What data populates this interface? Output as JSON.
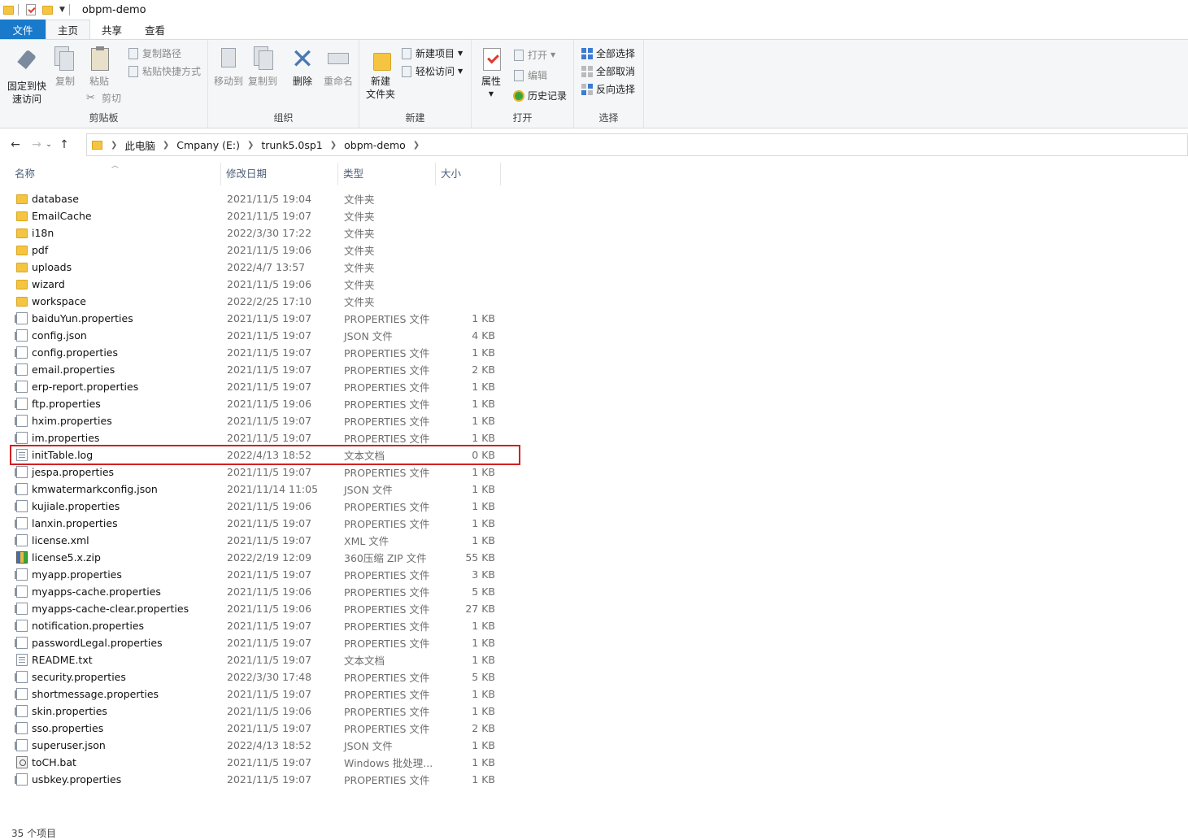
{
  "window": {
    "title": "obpm-demo"
  },
  "tabs": [
    {
      "label": "文件"
    },
    {
      "label": "主页"
    },
    {
      "label": "共享"
    },
    {
      "label": "查看"
    }
  ],
  "ribbon": {
    "clipboard": {
      "label": "剪贴板",
      "pin": "固定到快速访问",
      "pin_line1": "固定到快",
      "pin_line2": "速访问",
      "copy": "复制",
      "paste": "粘贴",
      "copy_path": "复制路径",
      "paste_shortcut": "粘贴快捷方式",
      "cut": "剪切"
    },
    "organize": {
      "label": "组织",
      "move_to": "移动到",
      "copy_to": "复制到",
      "delete": "删除",
      "rename": "重命名"
    },
    "new": {
      "label": "新建",
      "new_folder_line1": "新建",
      "new_folder_line2": "文件夹",
      "new_item": "新建项目",
      "easy_access": "轻松访问"
    },
    "open": {
      "label": "打开",
      "properties": "属性",
      "open": "打开",
      "edit": "编辑",
      "history": "历史记录"
    },
    "select": {
      "label": "选择",
      "select_all": "全部选择",
      "select_none": "全部取消",
      "invert": "反向选择"
    }
  },
  "address": {
    "crumbs": [
      "此电脑",
      "Cmpany (E:)",
      "trunk5.0sp1",
      "obpm-demo"
    ]
  },
  "columns": {
    "name": "名称",
    "date": "修改日期",
    "type": "类型",
    "size": "大小"
  },
  "files": [
    {
      "name": "database",
      "date": "2021/11/5 19:04",
      "type": "文件夹",
      "size": "",
      "icon": "folder"
    },
    {
      "name": "EmailCache",
      "date": "2021/11/5 19:07",
      "type": "文件夹",
      "size": "",
      "icon": "folder"
    },
    {
      "name": "i18n",
      "date": "2022/3/30 17:22",
      "type": "文件夹",
      "size": "",
      "icon": "folder"
    },
    {
      "name": "pdf",
      "date": "2021/11/5 19:06",
      "type": "文件夹",
      "size": "",
      "icon": "folder"
    },
    {
      "name": "uploads",
      "date": "2022/4/7 13:57",
      "type": "文件夹",
      "size": "",
      "icon": "folder"
    },
    {
      "name": "wizard",
      "date": "2021/11/5 19:06",
      "type": "文件夹",
      "size": "",
      "icon": "folder"
    },
    {
      "name": "workspace",
      "date": "2022/2/25 17:10",
      "type": "文件夹",
      "size": "",
      "icon": "folder"
    },
    {
      "name": "baiduYun.properties",
      "date": "2021/11/5 19:07",
      "type": "PROPERTIES 文件",
      "size": "1 KB",
      "icon": "file"
    },
    {
      "name": "config.json",
      "date": "2021/11/5 19:07",
      "type": "JSON 文件",
      "size": "4 KB",
      "icon": "file"
    },
    {
      "name": "config.properties",
      "date": "2021/11/5 19:07",
      "type": "PROPERTIES 文件",
      "size": "1 KB",
      "icon": "file"
    },
    {
      "name": "email.properties",
      "date": "2021/11/5 19:07",
      "type": "PROPERTIES 文件",
      "size": "2 KB",
      "icon": "file"
    },
    {
      "name": "erp-report.properties",
      "date": "2021/11/5 19:07",
      "type": "PROPERTIES 文件",
      "size": "1 KB",
      "icon": "file"
    },
    {
      "name": "ftp.properties",
      "date": "2021/11/5 19:06",
      "type": "PROPERTIES 文件",
      "size": "1 KB",
      "icon": "file"
    },
    {
      "name": "hxim.properties",
      "date": "2021/11/5 19:07",
      "type": "PROPERTIES 文件",
      "size": "1 KB",
      "icon": "file"
    },
    {
      "name": "im.properties",
      "date": "2021/11/5 19:07",
      "type": "PROPERTIES 文件",
      "size": "1 KB",
      "icon": "file"
    },
    {
      "name": "initTable.log",
      "date": "2022/4/13 18:52",
      "type": "文本文档",
      "size": "0 KB",
      "icon": "text",
      "highlighted": true
    },
    {
      "name": "jespa.properties",
      "date": "2021/11/5 19:07",
      "type": "PROPERTIES 文件",
      "size": "1 KB",
      "icon": "file"
    },
    {
      "name": "kmwatermarkconfig.json",
      "date": "2021/11/14 11:05",
      "type": "JSON 文件",
      "size": "1 KB",
      "icon": "file"
    },
    {
      "name": "kujiale.properties",
      "date": "2021/11/5 19:06",
      "type": "PROPERTIES 文件",
      "size": "1 KB",
      "icon": "file"
    },
    {
      "name": "lanxin.properties",
      "date": "2021/11/5 19:07",
      "type": "PROPERTIES 文件",
      "size": "1 KB",
      "icon": "file"
    },
    {
      "name": "license.xml",
      "date": "2021/11/5 19:07",
      "type": "XML 文件",
      "size": "1 KB",
      "icon": "file"
    },
    {
      "name": "license5.x.zip",
      "date": "2022/2/19 12:09",
      "type": "360压缩 ZIP 文件",
      "size": "55 KB",
      "icon": "zip"
    },
    {
      "name": "myapp.properties",
      "date": "2021/11/5 19:07",
      "type": "PROPERTIES 文件",
      "size": "3 KB",
      "icon": "file"
    },
    {
      "name": "myapps-cache.properties",
      "date": "2021/11/5 19:06",
      "type": "PROPERTIES 文件",
      "size": "5 KB",
      "icon": "file"
    },
    {
      "name": "myapps-cache-clear.properties",
      "date": "2021/11/5 19:06",
      "type": "PROPERTIES 文件",
      "size": "27 KB",
      "icon": "file"
    },
    {
      "name": "notification.properties",
      "date": "2021/11/5 19:07",
      "type": "PROPERTIES 文件",
      "size": "1 KB",
      "icon": "file"
    },
    {
      "name": "passwordLegal.properties",
      "date": "2021/11/5 19:07",
      "type": "PROPERTIES 文件",
      "size": "1 KB",
      "icon": "file"
    },
    {
      "name": "README.txt",
      "date": "2021/11/5 19:07",
      "type": "文本文档",
      "size": "1 KB",
      "icon": "text"
    },
    {
      "name": "security.properties",
      "date": "2022/3/30 17:48",
      "type": "PROPERTIES 文件",
      "size": "5 KB",
      "icon": "file"
    },
    {
      "name": "shortmessage.properties",
      "date": "2021/11/5 19:07",
      "type": "PROPERTIES 文件",
      "size": "1 KB",
      "icon": "file"
    },
    {
      "name": "skin.properties",
      "date": "2021/11/5 19:06",
      "type": "PROPERTIES 文件",
      "size": "1 KB",
      "icon": "file"
    },
    {
      "name": "sso.properties",
      "date": "2021/11/5 19:07",
      "type": "PROPERTIES 文件",
      "size": "2 KB",
      "icon": "file"
    },
    {
      "name": "superuser.json",
      "date": "2022/4/13 18:52",
      "type": "JSON 文件",
      "size": "1 KB",
      "icon": "file"
    },
    {
      "name": "toCH.bat",
      "date": "2021/11/5 19:07",
      "type": "Windows 批处理...",
      "size": "1 KB",
      "icon": "bat"
    },
    {
      "name": "usbkey.properties",
      "date": "2021/11/5 19:07",
      "type": "PROPERTIES 文件",
      "size": "1 KB",
      "icon": "file"
    }
  ],
  "status": {
    "item_count": "35 个项目"
  },
  "colors": {
    "file_tab": "#1979ca",
    "highlight_box": "#d32020",
    "folder": "#f5c542"
  }
}
